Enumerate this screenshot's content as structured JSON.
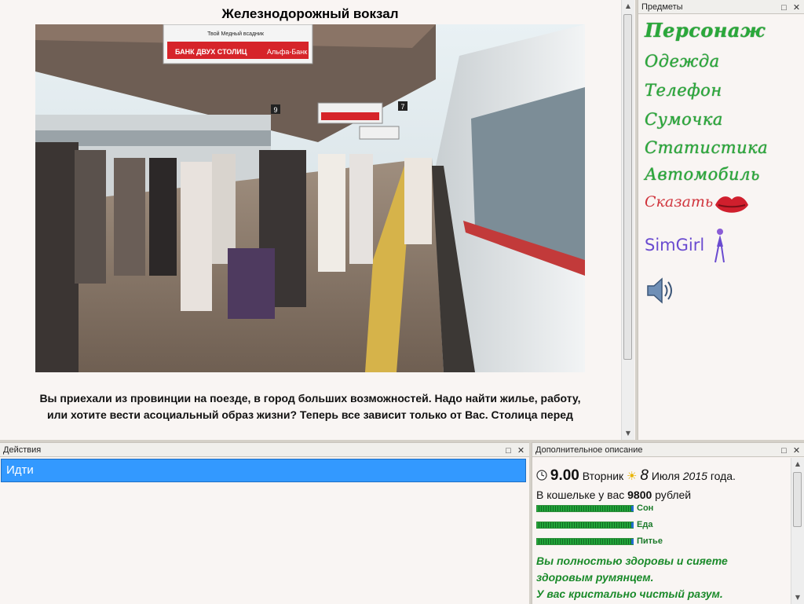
{
  "main": {
    "location_title": "Железнодорожный вокзал",
    "description_line1": "Вы приехали из провинции на поезде, в город больших возможностей. Надо найти жилье, работу,",
    "description_line2": "или хотите вести асоциальный образ жизни? Теперь все зависит только от Вас. Столица перед",
    "scene": {
      "banner_top": "БАНК ДВУХ СТОЛИЦ",
      "banner_top_brand": "Альфа-Банк",
      "banner_top_small": "Твой Медный всадник",
      "platform_sign_1": "9",
      "platform_sign_2": "7"
    }
  },
  "items_panel": {
    "title": "Предметы",
    "items": [
      {
        "label": "Персонаж"
      },
      {
        "label": "Одежда"
      },
      {
        "label": "Телефон"
      },
      {
        "label": "Сумочка"
      },
      {
        "label": "Статистика"
      },
      {
        "label": "Автомобиль"
      },
      {
        "label": "Сказать"
      },
      {
        "label": "SimGirl"
      }
    ],
    "icons": [
      "lips-icon",
      "girl-figure-icon",
      "speaker-icon"
    ]
  },
  "actions_panel": {
    "title": "Действия",
    "items": [
      {
        "label": "Идти"
      }
    ]
  },
  "extra_panel": {
    "title": "Дополнительное описание",
    "time": "9.00",
    "weekday": "Вторник",
    "day": "8",
    "month": "Июля",
    "year": "2015",
    "year_suffix": "года.",
    "wallet_prefix": "В кошельке у вас",
    "wallet_amount": "9800",
    "wallet_suffix": "рублей",
    "bars": [
      {
        "label": "Сон",
        "level": 1.0
      },
      {
        "label": "Еда",
        "level": 1.0
      },
      {
        "label": "Питье",
        "level": 1.0
      }
    ],
    "health_line1": "Вы полностью здоровы и сияете",
    "health_line2": "здоровым румянцем.",
    "health_line3": "У вас кристально чистый разум."
  },
  "panel_controls": {
    "restore": "□",
    "close": "✕"
  },
  "colors": {
    "accent": "#3399ff",
    "status_green": "#1a8a2a",
    "item_green": "#2aa83a"
  }
}
